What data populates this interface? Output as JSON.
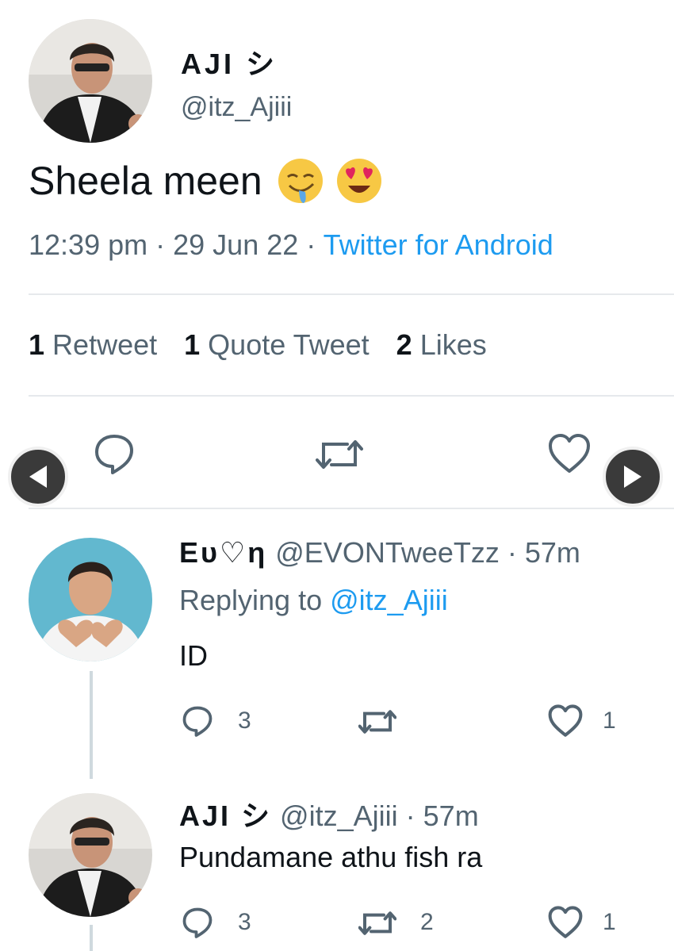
{
  "tweet": {
    "author_name": "AJI シ",
    "author_handle": "@itz_Ajiii",
    "text": "Sheela meen",
    "emojis": [
      "drooling-face",
      "heart-eyes-face"
    ],
    "time": "12:39 pm",
    "date": "29 Jun 22",
    "source": "Twitter for Android",
    "stats": {
      "retweets_count": "1",
      "retweets_label": "Retweet",
      "quotes_count": "1",
      "quotes_label": "Quote Tweet",
      "likes_count": "2",
      "likes_label": "Likes"
    }
  },
  "replies": [
    {
      "author_name": "Eυ♡η",
      "author_handle": "@EVONTweeTzz",
      "time": "57m",
      "replying_label": "Replying to",
      "replying_to": "@itz_Ajiii",
      "text": "ID",
      "reply_count": "3",
      "retweet_count": "",
      "like_count": "1"
    },
    {
      "author_name": "AJI シ",
      "author_handle": "@itz_Ajiii",
      "time": "57m",
      "text": "Pundamane athu fish ra",
      "reply_count": "3",
      "retweet_count": "2",
      "like_count": "1"
    }
  ],
  "colors": {
    "link": "#1d9bf0",
    "muted": "#536471",
    "text": "#0f1419",
    "divider": "#e6e9ec"
  }
}
